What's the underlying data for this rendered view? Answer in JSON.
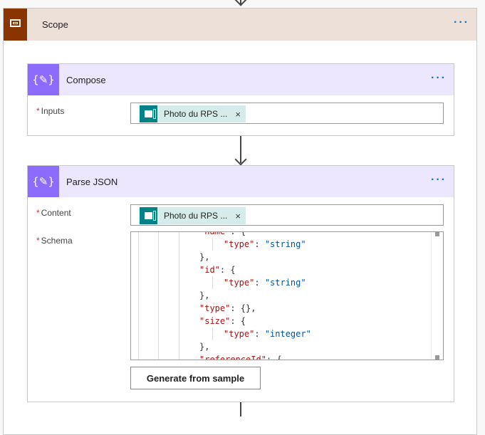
{
  "scope": {
    "title": "Scope",
    "icon": "scope-icon",
    "color": "#8a3500",
    "more": "···"
  },
  "compose": {
    "title": "Compose",
    "icon": "compose-braces-icon",
    "color": "#8c6cff",
    "more": "···",
    "inputs_label": "Inputs",
    "required": "*",
    "inputs_token": {
      "label": "Photo du RPS ...",
      "icon": "microsoft-forms-icon",
      "remove": "×"
    }
  },
  "parse_json": {
    "title": "Parse JSON",
    "icon": "compose-braces-icon",
    "more": "···",
    "content_label": "Content",
    "schema_label": "Schema",
    "required": "*",
    "content_token": {
      "label": "Photo du RPS ...",
      "icon": "microsoft-forms-icon",
      "remove": "×"
    },
    "schema_lines": [
      {
        "indent": 0,
        "tokens": [
          {
            "t": "\"name\"",
            "c": "k"
          },
          {
            "t": ": {",
            "c": "p"
          }
        ]
      },
      {
        "indent": 1,
        "tokens": [
          {
            "t": "\"type\"",
            "c": "k"
          },
          {
            "t": ": ",
            "c": "p"
          },
          {
            "t": "\"string\"",
            "c": "s"
          }
        ]
      },
      {
        "indent": 0,
        "tokens": [
          {
            "t": "},",
            "c": "p"
          }
        ]
      },
      {
        "indent": 0,
        "tokens": [
          {
            "t": "\"id\"",
            "c": "k"
          },
          {
            "t": ": {",
            "c": "p"
          }
        ]
      },
      {
        "indent": 1,
        "tokens": [
          {
            "t": "\"type\"",
            "c": "k"
          },
          {
            "t": ": ",
            "c": "p"
          },
          {
            "t": "\"string\"",
            "c": "s"
          }
        ]
      },
      {
        "indent": 0,
        "tokens": [
          {
            "t": "},",
            "c": "p"
          }
        ]
      },
      {
        "indent": 0,
        "tokens": [
          {
            "t": "\"type\"",
            "c": "k"
          },
          {
            "t": ": {},",
            "c": "p"
          }
        ]
      },
      {
        "indent": 0,
        "tokens": [
          {
            "t": "\"size\"",
            "c": "k"
          },
          {
            "t": ": {",
            "c": "p"
          }
        ]
      },
      {
        "indent": 1,
        "tokens": [
          {
            "t": "\"type\"",
            "c": "k"
          },
          {
            "t": ": ",
            "c": "p"
          },
          {
            "t": "\"integer\"",
            "c": "s"
          }
        ]
      },
      {
        "indent": 0,
        "tokens": [
          {
            "t": "},",
            "c": "p"
          }
        ]
      },
      {
        "indent": 0,
        "tokens": [
          {
            "t": "\"referenceId\"",
            "c": "k"
          },
          {
            "t": ": {",
            "c": "p"
          }
        ]
      }
    ],
    "generate_button": "Generate from sample"
  }
}
